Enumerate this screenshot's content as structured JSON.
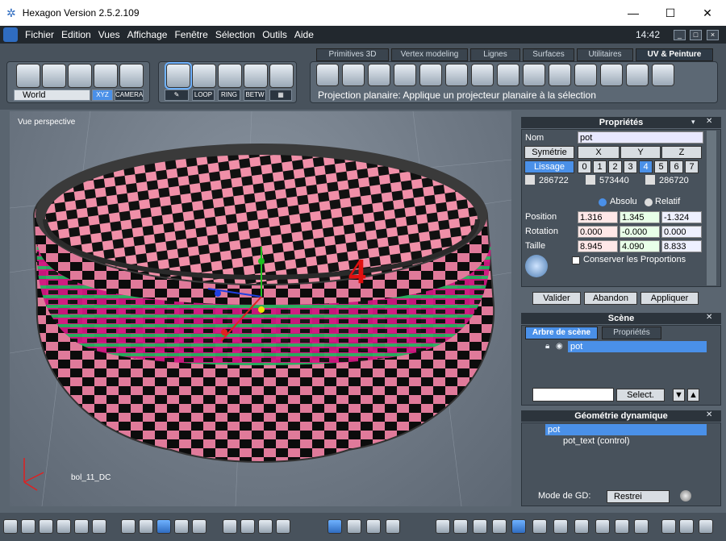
{
  "window": {
    "title": "Hexagon Version 2.5.2.109",
    "minimize": "—",
    "maximize": "☐",
    "close": "✕"
  },
  "menu": {
    "items": [
      "Fichier",
      "Edition",
      "Vues",
      "Affichage",
      "Fenêtre",
      "Sélection",
      "Outils",
      "Aide"
    ],
    "clock": "14:42"
  },
  "toolbar": {
    "world_select": "World",
    "xyz_label": "XYZ",
    "camera_label": "CAMERA",
    "loop_label": "LOOP",
    "ring_label": "RING",
    "betw_label": "BETW",
    "tabs": [
      "Primitives 3D",
      "Vertex modeling",
      "Lignes",
      "Surfaces",
      "Utilitaires",
      "UV & Peinture"
    ],
    "active_tab": "UV & Peinture",
    "status": "Projection planaire: Applique un projecteur planaire à la sélection"
  },
  "viewport": {
    "title": "Vue perspective",
    "label_number": "4",
    "object_name": "bol_11_DC"
  },
  "properties": {
    "title": "Propriétés",
    "name_label": "Nom",
    "name_value": "pot",
    "symmetry_button": "Symétrie",
    "axes": [
      "X",
      "Y",
      "Z"
    ],
    "smoothing_button": "Lissage",
    "levels": [
      "0",
      "1",
      "2",
      "3",
      "4",
      "5",
      "6",
      "7"
    ],
    "active_level": "4",
    "counts": [
      "286722",
      "573440",
      "286720"
    ],
    "absolute_label": "Absolu",
    "relative_label": "Relatif",
    "rows": [
      {
        "label": "Position",
        "x": "1.316",
        "y": "1.345",
        "z": "-1.324"
      },
      {
        "label": "Rotation",
        "x": "0.000",
        "y": "-0.000",
        "z": "0.000"
      },
      {
        "label": "Taille",
        "x": "8.945",
        "y": "4.090",
        "z": "8.833"
      }
    ],
    "keep_proportions": "Conserver les Proportions",
    "validate": "Valider",
    "cancel": "Abandon",
    "apply": "Appliquer"
  },
  "scene": {
    "title": "Scène",
    "tab_tree": "Arbre de scène",
    "tab_props": "Propriétés",
    "item": "pot",
    "select_button": "Select."
  },
  "dyn_geo": {
    "title": "Géométrie dynamique",
    "item": "pot",
    "child": "pot_text (control)",
    "mode_label": "Mode de GD:",
    "mode_value": "Restrei"
  },
  "colors": {
    "accent": "#4a90e8",
    "bg": "#48525c",
    "dark": "#22282e"
  }
}
